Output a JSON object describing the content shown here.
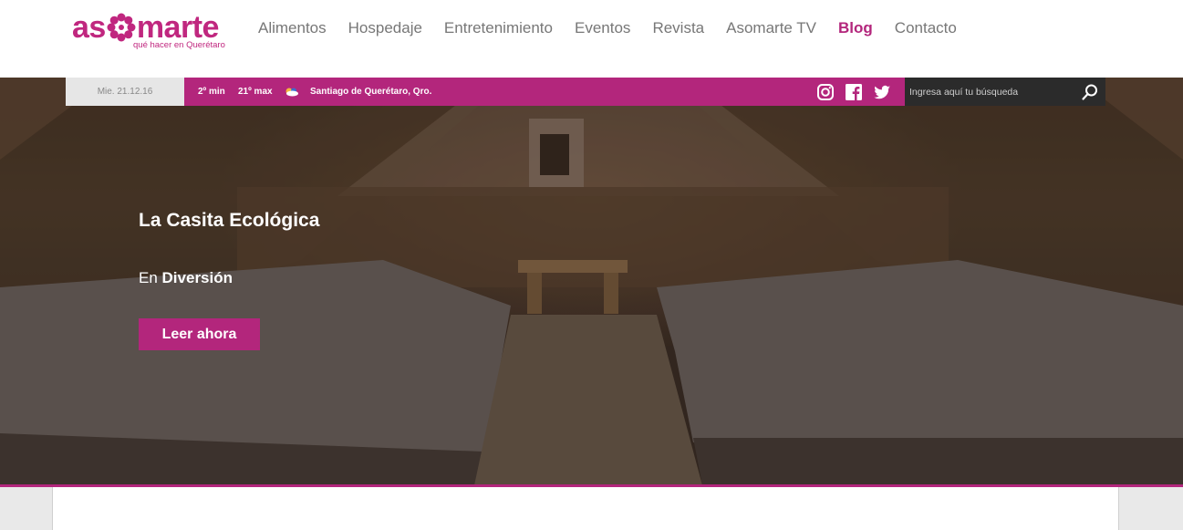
{
  "brand": {
    "name_prefix": "as",
    "name_suffix": "marte",
    "tagline": "qué hacer en Querétaro",
    "color": "#c0277f"
  },
  "nav": [
    {
      "label": "Alimentos"
    },
    {
      "label": "Hospedaje"
    },
    {
      "label": "Entretenimiento"
    },
    {
      "label": "Eventos"
    },
    {
      "label": "Revista"
    },
    {
      "label": "Asomarte TV"
    },
    {
      "label": "Blog"
    },
    {
      "label": "Contacto"
    }
  ],
  "infobar": {
    "date": "Mie. 21.12.16",
    "min_temp": "2º min",
    "max_temp": "21º max",
    "weather_icon": "partly-cloudy-icon",
    "city": "Santiago de Querétaro, Qro.",
    "social": [
      "instagram-icon",
      "facebook-icon",
      "twitter-icon"
    ],
    "search_placeholder": "Ingresa aquí tu búsqueda"
  },
  "hero": {
    "title": "La Casita Ecológica",
    "category_prefix": "En",
    "category": "Diversión",
    "cta": "Leer ahora"
  },
  "colors": {
    "accent": "#b3267c",
    "search_bg": "#2b2b2b",
    "date_bg": "#e6e6e6"
  }
}
